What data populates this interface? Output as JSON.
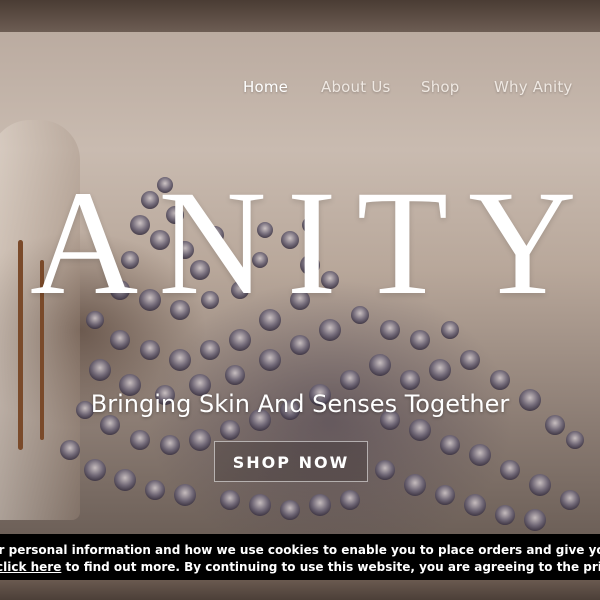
{
  "nav": {
    "items": [
      {
        "label": "Home",
        "active": true
      },
      {
        "label": "About Us",
        "active": false
      },
      {
        "label": "Shop",
        "active": false
      },
      {
        "label": "Why Anity",
        "active": false
      }
    ]
  },
  "hero": {
    "brand": "ANITY",
    "tagline": "Bringing Skin And Senses Together",
    "cta_label": "SHOP NOW"
  },
  "cookie_banner": {
    "line1": "ur personal information and how we use cookies to enable you to place orders and give you the best",
    "link_text": "click here",
    "line2_rest": " to find out more. By continuing to use this website, you are agreeing to the privacy policy ar"
  },
  "colors": {
    "text_light": "#ffffff",
    "banner_bg": "#000000"
  }
}
